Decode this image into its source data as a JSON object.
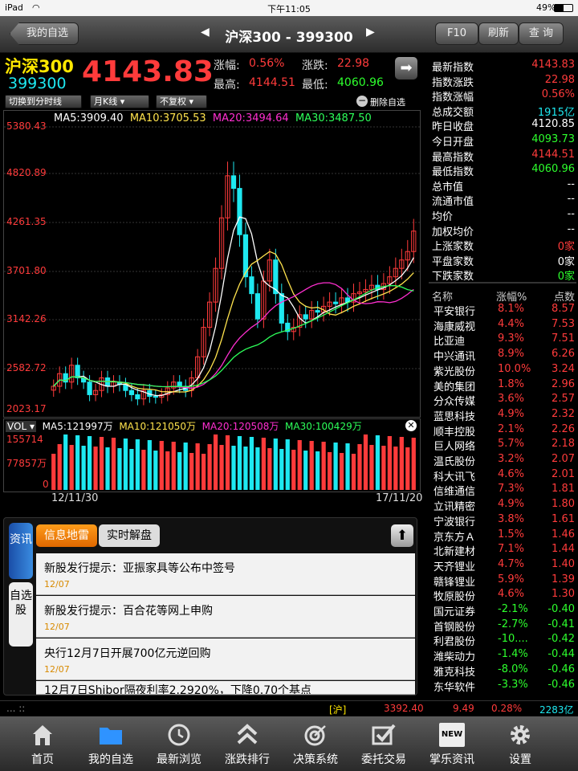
{
  "status": {
    "device": "iPad",
    "time": "下午11:05",
    "battery": "49%"
  },
  "nav": {
    "back": "我的自选",
    "title": "沪深300 - 399300",
    "prev": "◀",
    "next": "▶",
    "f10": "F10",
    "refresh": "刷新",
    "query": "查 询"
  },
  "quote": {
    "name": "沪深300",
    "code": "399300",
    "price": "4143.83",
    "pct_label": "涨幅:",
    "pct": "0.56%",
    "chg_label": "涨跌:",
    "chg": "22.98",
    "high_label": "最高:",
    "high": "4144.51",
    "low_label": "最低:",
    "low": "4060.96"
  },
  "controls": {
    "switch": "切换到分时线",
    "period": "月K线 ▾",
    "adjust": "不复权 ▾",
    "delete": "删除自选"
  },
  "chart_data": {
    "type": "candlestick",
    "period": "monthly",
    "y_ticks": [
      "5380.43",
      "4820.89",
      "4261.35",
      "3701.80",
      "3142.26",
      "2582.72",
      "2023.17"
    ],
    "ylim": [
      2023.17,
      5380.43
    ],
    "x_range": [
      "12/11/30",
      "17/11/20"
    ],
    "ma": [
      {
        "name": "MA5",
        "value": "3909.40",
        "color": "#ffffff"
      },
      {
        "name": "MA10",
        "value": "3705.53",
        "color": "#ffe34d"
      },
      {
        "name": "MA20",
        "value": "3494.64",
        "color": "#ff2fd0"
      },
      {
        "name": "MA30",
        "value": "3487.50",
        "color": "#2dff5a"
      }
    ],
    "closes": [
      2300,
      2450,
      2350,
      2550,
      2400,
      2350,
      2200,
      2250,
      2400,
      2300,
      2350,
      2320,
      2250,
      2200,
      2150,
      2250,
      2180,
      2170,
      2200,
      2280,
      2350,
      2300,
      2250,
      2400,
      2650,
      3000,
      3300,
      3700,
      4300,
      4800,
      4650,
      4100,
      3600,
      3400,
      3100,
      3550,
      3800,
      3400,
      3050,
      2950,
      3000,
      3150,
      3100,
      3200,
      3180,
      3250,
      3300,
      3280,
      3350,
      3300,
      3400,
      3420,
      3450,
      3500,
      3450,
      3520,
      3600,
      3700,
      3800,
      3900,
      4143
    ]
  },
  "vol": {
    "label": "VOL",
    "ma": [
      {
        "name": "MA5",
        "value": "121997万",
        "color": "#ffffff"
      },
      {
        "name": "MA10",
        "value": "121050万",
        "color": "#ffe34d"
      },
      {
        "name": "MA20",
        "value": "120508万",
        "color": "#ff2fd0"
      },
      {
        "name": "MA30",
        "value": "100429万",
        "color": "#2dff5a"
      }
    ],
    "ticks": [
      "155714",
      "77857万",
      "0"
    ]
  },
  "dates": {
    "start": "12/11/30",
    "end": "17/11/20"
  },
  "news": {
    "vtab1": "资讯",
    "vtab2": "自选股",
    "tab1": "信息地雷",
    "tab2": "实时解盘",
    "items": [
      {
        "title": "新股发行提示：亚振家具等公布中签号",
        "date": "12/07"
      },
      {
        "title": "新股发行提示：百合花等网上申购",
        "date": "12/07"
      },
      {
        "title": "央行12月7日开展700亿元逆回购",
        "date": "12/07"
      },
      {
        "title": "12月7日Shibor隔夜利率2.2920%，下降0.70个基点",
        "date": ""
      }
    ]
  },
  "stats": [
    {
      "k": "最新指数",
      "v": "4143.83",
      "c": "red"
    },
    {
      "k": "指数涨跌",
      "v": "22.98",
      "c": "red"
    },
    {
      "k": "指数涨幅",
      "v": "0.56%",
      "c": "red"
    },
    {
      "k": "总成交额",
      "v": "1915亿",
      "c": "cyan"
    },
    {
      "k": "昨日收盘",
      "v": "4120.85",
      "c": "white"
    },
    {
      "k": "今日开盘",
      "v": "4093.73",
      "c": "green"
    },
    {
      "k": "最高指数",
      "v": "4144.51",
      "c": "red"
    },
    {
      "k": "最低指数",
      "v": "4060.96",
      "c": "green"
    },
    {
      "k": "总市值",
      "v": "--",
      "c": "white"
    },
    {
      "k": "流通市值",
      "v": "--",
      "c": "white"
    },
    {
      "k": "均价",
      "v": "--",
      "c": "white"
    },
    {
      "k": "加权均价",
      "v": "--",
      "c": "white"
    },
    {
      "k": "上涨家数",
      "v": "0家",
      "c": "red"
    },
    {
      "k": "平盘家数",
      "v": "0家",
      "c": "white"
    },
    {
      "k": "下跌家数",
      "v": "0家",
      "c": "green"
    }
  ],
  "stock_header": {
    "name": "名称",
    "pct": "涨幅%",
    "pts": "点数"
  },
  "stocks": [
    {
      "n": "平安银行",
      "p": "8.1%",
      "v": "8.57",
      "c": "red"
    },
    {
      "n": "海康威视",
      "p": "4.4%",
      "v": "7.53",
      "c": "red"
    },
    {
      "n": "比亚迪",
      "p": "9.3%",
      "v": "7.51",
      "c": "red"
    },
    {
      "n": "中兴通讯",
      "p": "8.9%",
      "v": "6.26",
      "c": "red"
    },
    {
      "n": "紫光股份",
      "p": "10.0%",
      "v": "3.24",
      "c": "red"
    },
    {
      "n": "美的集团",
      "p": "1.8%",
      "v": "2.96",
      "c": "red"
    },
    {
      "n": "分众传媒",
      "p": "3.6%",
      "v": "2.57",
      "c": "red"
    },
    {
      "n": "蓝思科技",
      "p": "4.9%",
      "v": "2.32",
      "c": "red"
    },
    {
      "n": "顺丰控股",
      "p": "2.1%",
      "v": "2.26",
      "c": "red"
    },
    {
      "n": "巨人网络",
      "p": "5.7%",
      "v": "2.18",
      "c": "red"
    },
    {
      "n": "温氏股份",
      "p": "3.2%",
      "v": "2.07",
      "c": "red"
    },
    {
      "n": "科大讯飞",
      "p": "4.6%",
      "v": "2.01",
      "c": "red"
    },
    {
      "n": "信维通信",
      "p": "7.3%",
      "v": "1.81",
      "c": "red"
    },
    {
      "n": "立讯精密",
      "p": "4.9%",
      "v": "1.80",
      "c": "red"
    },
    {
      "n": "宁波银行",
      "p": "3.8%",
      "v": "1.61",
      "c": "red"
    },
    {
      "n": "京东方Ａ",
      "p": "1.5%",
      "v": "1.46",
      "c": "red"
    },
    {
      "n": "北新建材",
      "p": "7.1%",
      "v": "1.44",
      "c": "red"
    },
    {
      "n": "天齐锂业",
      "p": "4.7%",
      "v": "1.40",
      "c": "red"
    },
    {
      "n": "赣锋锂业",
      "p": "5.9%",
      "v": "1.39",
      "c": "red"
    },
    {
      "n": "牧原股份",
      "p": "4.6%",
      "v": "1.30",
      "c": "red"
    },
    {
      "n": "国元证券",
      "p": "-2.1%",
      "v": "-0.40",
      "c": "green"
    },
    {
      "n": "首钢股份",
      "p": "-2.7%",
      "v": "-0.41",
      "c": "green"
    },
    {
      "n": "利君股份",
      "p": "-10....",
      "v": "-0.42",
      "c": "green"
    },
    {
      "n": "潍柴动力",
      "p": "-1.4%",
      "v": "-0.44",
      "c": "green"
    },
    {
      "n": "雅克科技",
      "p": "-8.0%",
      "v": "-0.46",
      "c": "green"
    },
    {
      "n": "东华软件",
      "p": "-3.3%",
      "v": "-0.46",
      "c": "green"
    }
  ],
  "statusbar": {
    "dots": "... ::",
    "market": "[沪]",
    "idx": "3392.40",
    "chg": "9.49",
    "pct": "0.28%",
    "amt": "2283亿"
  },
  "tabs": [
    {
      "label": "首页",
      "icon": "home-icon"
    },
    {
      "label": "我的自选",
      "icon": "folder-icon"
    },
    {
      "label": "最新浏览",
      "icon": "clock-icon"
    },
    {
      "label": "涨跌排行",
      "icon": "rank-icon"
    },
    {
      "label": "决策系统",
      "icon": "target-icon"
    },
    {
      "label": "委托交易",
      "icon": "check-icon"
    },
    {
      "label": "掌乐资讯",
      "icon": "news-icon"
    },
    {
      "label": "设置",
      "icon": "gear-icon"
    }
  ]
}
